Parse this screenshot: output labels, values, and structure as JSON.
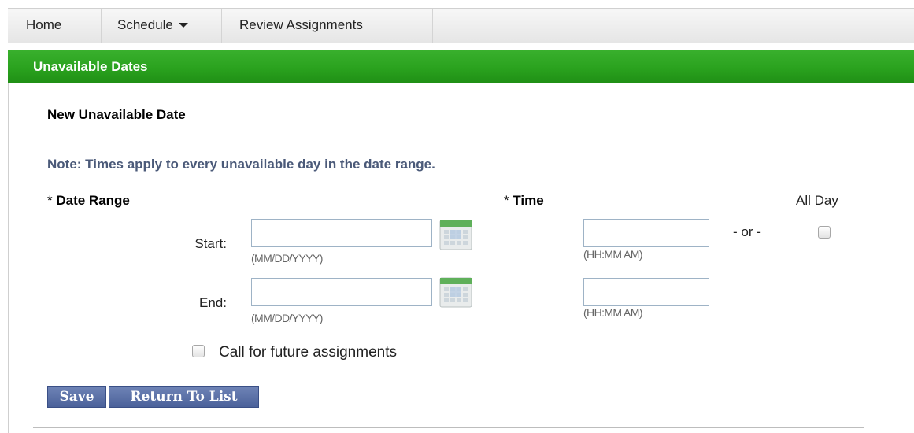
{
  "nav": {
    "home": "Home",
    "schedule": "Schedule",
    "review": "Review Assignments"
  },
  "panel": {
    "title": "Unavailable Dates"
  },
  "form": {
    "section_title": "New Unavailable Date",
    "note": "Note: Times apply to every unavailable day in the date range.",
    "required_marker": "*",
    "date_range_label": "Date Range",
    "time_label": "Time",
    "all_day_label": "All Day",
    "start_label": "Start:",
    "end_label": "End:",
    "date_hint": "(MM/DD/YYYY)",
    "time_hint": "(HH:MM AM)",
    "or_text": "- or -",
    "start_date_value": "",
    "end_date_value": "",
    "start_time_value": "",
    "end_time_value": "",
    "all_day_checked": false,
    "future_checked": false,
    "future_label": "Call for future assignments"
  },
  "buttons": {
    "save": "Save",
    "return_to_list": "Return To List"
  },
  "icons": {
    "calendar": "calendar-icon",
    "dropdown": "caret-down-icon"
  },
  "colors": {
    "header_green": "#2aa21e",
    "note_text": "#4b5a79",
    "button_blue": "#4b619a"
  }
}
